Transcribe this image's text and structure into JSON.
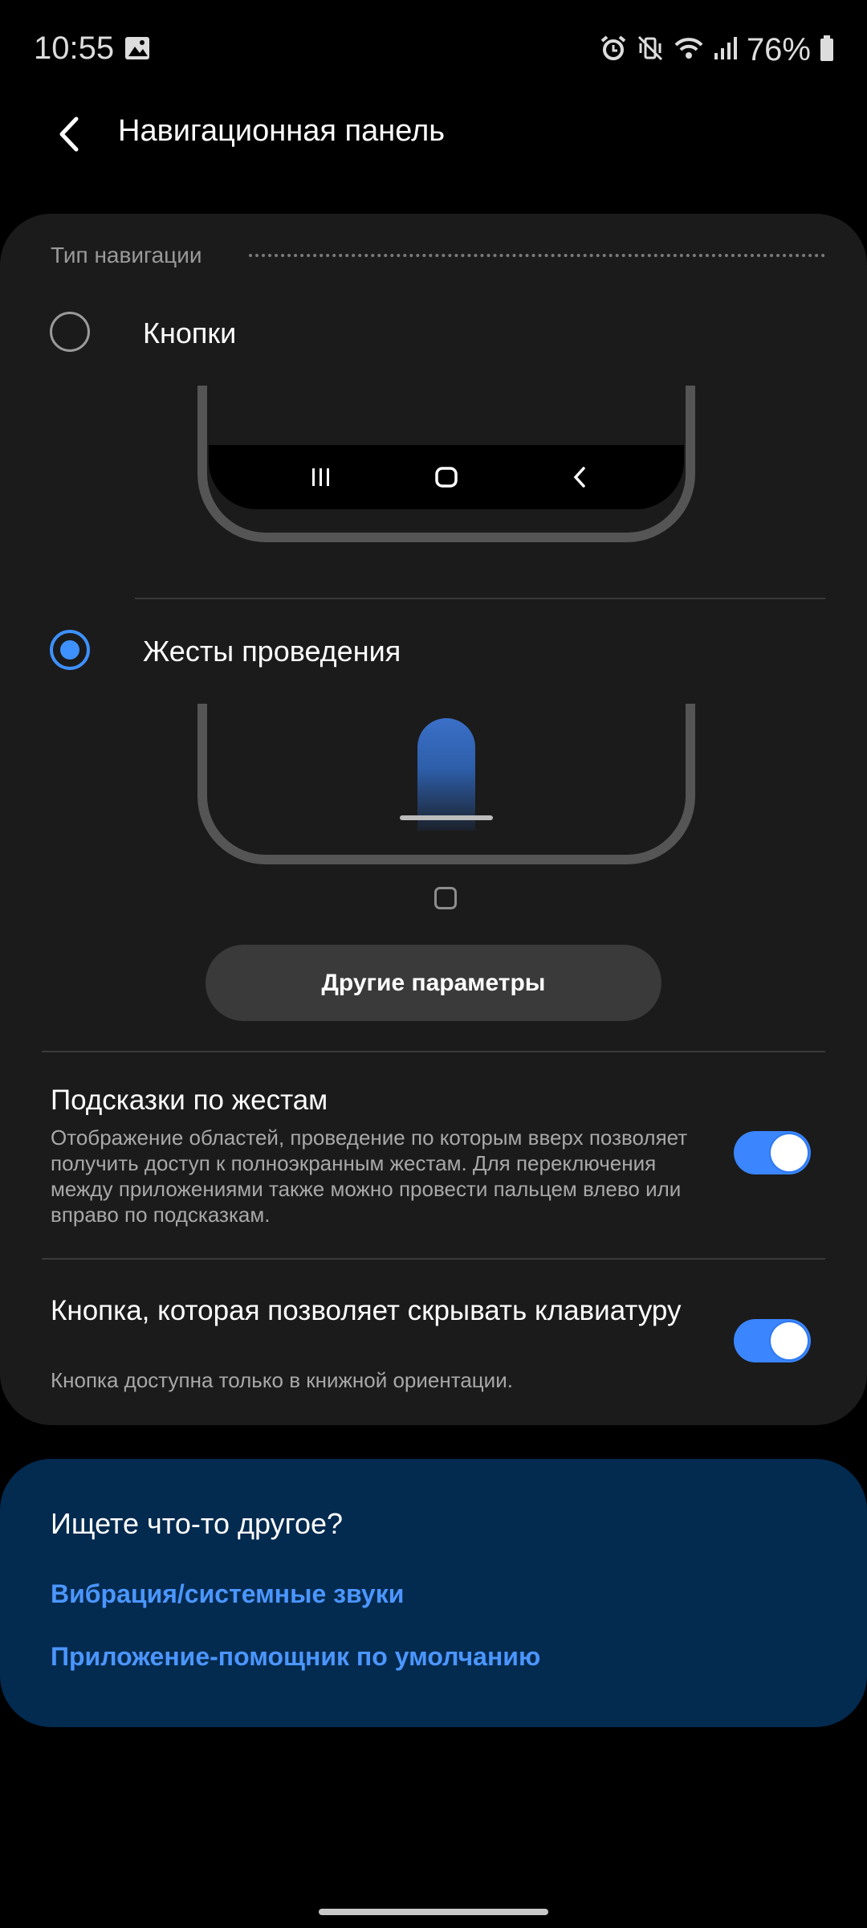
{
  "status_bar": {
    "time": "10:55",
    "battery": "76%",
    "icons": [
      "gallery-icon",
      "alarm-icon",
      "vibrate-mute-icon",
      "wifi-icon",
      "signal-icon",
      "battery-icon"
    ]
  },
  "app_bar": {
    "title": "Навигационная панель"
  },
  "navigation_type": {
    "header": "Тип навигации",
    "options": [
      {
        "label": "Кнопки",
        "selected": false
      },
      {
        "label": "Жесты проведения",
        "selected": true
      }
    ],
    "more_options_button": "Другие параметры"
  },
  "settings": [
    {
      "title": "Подсказки по жестам",
      "description": "Отображение областей, проведение по которым вверх позволяет получить доступ к полноэкранным жестам. Для переключения между приложениями также можно провести пальцем влево или вправо по подсказкам.",
      "enabled": true
    },
    {
      "title": "Кнопка, которая позволяет скрывать клавиатуру",
      "description": "Кнопка доступна только в книжной ориентации.",
      "enabled": true
    }
  ],
  "suggestions": {
    "title": "Ищете что-то другое?",
    "links": [
      "Вибрация/системные звуки",
      "Приложение-помощник по умолчанию"
    ]
  },
  "colors": {
    "accent": "#3e91ff",
    "card_bg": "#1b1b1b",
    "suggest_bg": "#032a4f",
    "link": "#4b96ff"
  }
}
